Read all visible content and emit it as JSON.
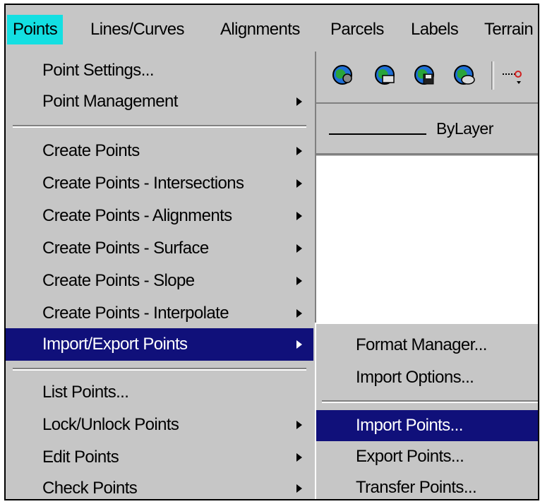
{
  "menubar": {
    "items": [
      {
        "label": "Points",
        "active": true
      },
      {
        "label": "Lines/Curves"
      },
      {
        "label": "Alignments"
      },
      {
        "label": "Parcels"
      },
      {
        "label": "Labels"
      },
      {
        "label": "Terrain"
      }
    ]
  },
  "toolbar": {
    "icons": [
      "globe-gear-icon",
      "globe-print-icon",
      "globe-save-icon",
      "globe-mail-icon",
      "point-line-icon"
    ],
    "linetype_label": "ByLayer"
  },
  "points_menu": {
    "items": [
      {
        "label": "Point Settings...",
        "has_submenu": false
      },
      {
        "label": "Point Management",
        "has_submenu": true
      },
      {
        "label": "Create Points",
        "has_submenu": true
      },
      {
        "label": "Create Points - Intersections",
        "has_submenu": true
      },
      {
        "label": "Create Points - Alignments",
        "has_submenu": true
      },
      {
        "label": "Create Points - Surface",
        "has_submenu": true
      },
      {
        "label": "Create Points - Slope",
        "has_submenu": true
      },
      {
        "label": "Create Points - Interpolate",
        "has_submenu": true
      },
      {
        "label": "Import/Export Points",
        "has_submenu": true,
        "highlighted": true
      },
      {
        "label": "List Points...",
        "has_submenu": false
      },
      {
        "label": "Lock/Unlock Points",
        "has_submenu": true
      },
      {
        "label": "Edit Points",
        "has_submenu": true
      },
      {
        "label": "Check Points",
        "has_submenu": true
      }
    ]
  },
  "import_export_submenu": {
    "items": [
      {
        "label": "Format Manager..."
      },
      {
        "label": "Import Options..."
      },
      {
        "label": "Import Points...",
        "highlighted": true
      },
      {
        "label": "Export Points..."
      },
      {
        "label": "Transfer Points..."
      }
    ]
  },
  "colors": {
    "menu_bg": "#c6c6c6",
    "highlight": "#10107a",
    "menubar_active": "#13dfe2"
  }
}
